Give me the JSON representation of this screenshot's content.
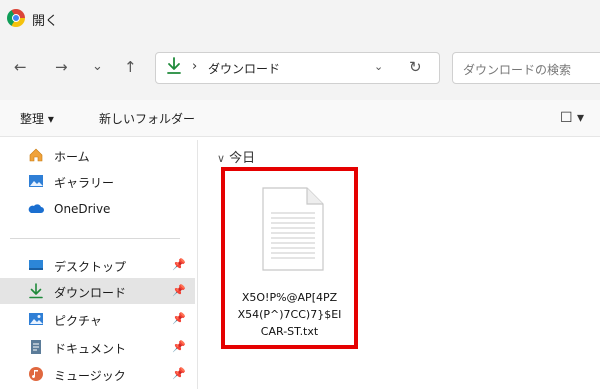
{
  "window": {
    "title": "開く",
    "app_icon": "chrome-icon"
  },
  "navigation": {
    "back": "←",
    "forward": "→",
    "recent": "⌄",
    "up": "↑",
    "address": {
      "icon": "download-icon",
      "separator": "›",
      "path": "ダウンロード",
      "dropdown": "⌄",
      "refresh": "↻"
    },
    "search": {
      "placeholder": "ダウンロードの検索"
    }
  },
  "toolbar": {
    "organize": "整理 ▾",
    "new_folder": "新しいフォルダー",
    "view": "☐ ▾"
  },
  "sidebar": {
    "items": [
      {
        "label": "ホーム",
        "icon": "home-icon",
        "pinned": false
      },
      {
        "label": "ギャラリー",
        "icon": "gallery-icon",
        "pinned": false
      },
      {
        "label": "OneDrive",
        "icon": "onedrive-icon",
        "pinned": false
      },
      {
        "label": "デスクトップ",
        "icon": "desktop-icon",
        "pinned": true
      },
      {
        "label": "ダウンロード",
        "icon": "download-icon",
        "pinned": true,
        "selected": true
      },
      {
        "label": "ピクチャ",
        "icon": "pictures-icon",
        "pinned": true
      },
      {
        "label": "ドキュメント",
        "icon": "documents-icon",
        "pinned": true
      },
      {
        "label": "ミュージック",
        "icon": "music-icon",
        "pinned": true
      }
    ],
    "pin_glyph": "📌"
  },
  "content": {
    "group_chevron": "∨",
    "group_label": "今日",
    "files": [
      {
        "name": "X5O!P%@AP[4PZ\nX54(P^)7CC)7}$EI\nCAR-ST.txt",
        "icon": "text-file-icon"
      }
    ]
  },
  "colors": {
    "highlight_border": "#e50000",
    "accent_download": "#1f8a3a",
    "selected_bg": "#e4e4e4"
  }
}
